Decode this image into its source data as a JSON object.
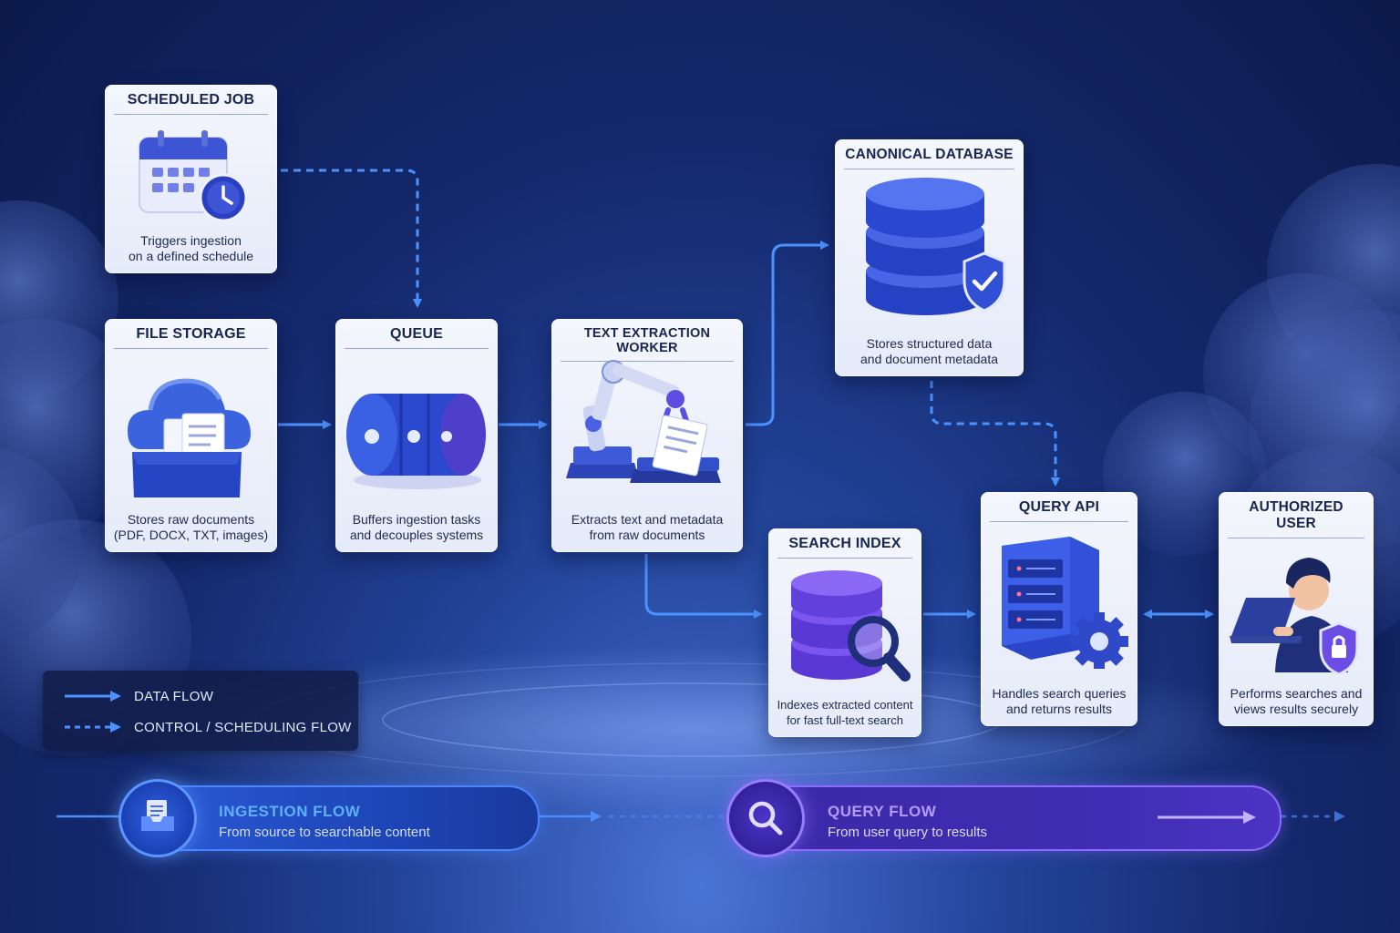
{
  "colors": {
    "accent_blue": "#3f88ff",
    "accent_purple": "#8b5cf6",
    "card_title": "#17264f",
    "background": "#14286b"
  },
  "nodes": {
    "scheduled_job": {
      "title": "SCHEDULED JOB",
      "description": "Triggers ingestion\non a defined schedule",
      "icon": "calendar-clock-icon"
    },
    "file_storage": {
      "title": "FILE STORAGE",
      "description": "Stores raw documents\n(PDF, DOCX, TXT, images)",
      "icon": "cloud-storage-icon"
    },
    "queue": {
      "title": "QUEUE",
      "description": "Buffers ingestion tasks\nand decouples systems",
      "icon": "queue-cylinder-icon"
    },
    "text_extraction_worker": {
      "title": "TEXT EXTRACTION WORKER",
      "description": "Extracts text and metadata\nfrom raw documents",
      "icon": "robot-arm-icon"
    },
    "canonical_database": {
      "title": "CANONICAL DATABASE",
      "description": "Stores structured data\nand document metadata",
      "icon": "database-shield-icon"
    },
    "search_index": {
      "title": "SEARCH INDEX",
      "description": "Indexes extracted content\nfor fast full-text search",
      "icon": "database-search-icon"
    },
    "query_api": {
      "title": "QUERY API",
      "description": "Handles search queries\nand returns results",
      "icon": "server-gear-icon"
    },
    "authorized_user": {
      "title": "AUTHORIZED USER",
      "description": "Performs searches and\nviews results securely",
      "icon": "user-laptop-icon"
    }
  },
  "legend": {
    "data_flow": "DATA FLOW",
    "control_flow": "CONTROL / SCHEDULING FLOW"
  },
  "flows": {
    "ingestion": {
      "title": "INGESTION FLOW",
      "subtitle": "From source to searchable content",
      "icon": "inbox-icon"
    },
    "query": {
      "title": "QUERY FLOW",
      "subtitle": "From user query to results",
      "icon": "search-icon"
    }
  }
}
